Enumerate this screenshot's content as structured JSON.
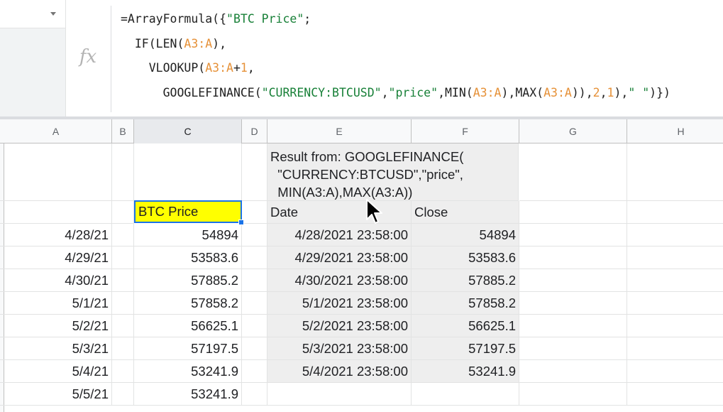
{
  "formula_bar": {
    "fx_label": "fx",
    "lines": [
      [
        {
          "t": "=ArrayFormula({",
          "c": "n"
        },
        {
          "t": "\"BTC Price\"",
          "c": "g"
        },
        {
          "t": ";",
          "c": "n"
        }
      ],
      [
        {
          "t": "  IF(LEN(",
          "c": "n"
        },
        {
          "t": "A3:A",
          "c": "o"
        },
        {
          "t": "),",
          "c": "n"
        }
      ],
      [
        {
          "t": "    VLOOKUP(",
          "c": "n"
        },
        {
          "t": "A3:A",
          "c": "o"
        },
        {
          "t": "+",
          "c": "n"
        },
        {
          "t": "1",
          "c": "o"
        },
        {
          "t": ",",
          "c": "n"
        }
      ],
      [
        {
          "t": "      GOOGLEFINANCE(",
          "c": "n"
        },
        {
          "t": "\"CURRENCY:BTCUSD\"",
          "c": "g"
        },
        {
          "t": ",",
          "c": "n"
        },
        {
          "t": "\"price\"",
          "c": "g"
        },
        {
          "t": ",MIN(",
          "c": "n"
        },
        {
          "t": "A3:A",
          "c": "o"
        },
        {
          "t": "),MAX(",
          "c": "n"
        },
        {
          "t": "A3:A",
          "c": "o"
        },
        {
          "t": ")),",
          "c": "n"
        },
        {
          "t": "2",
          "c": "o"
        },
        {
          "t": ",",
          "c": "n"
        },
        {
          "t": "1",
          "c": "o"
        },
        {
          "t": "),",
          "c": "n"
        },
        {
          "t": "\" \"",
          "c": "g"
        },
        {
          "t": ")})",
          "c": "n"
        }
      ]
    ]
  },
  "columns": [
    "A",
    "B",
    "C",
    "D",
    "E",
    "F",
    "G",
    "H"
  ],
  "note_text": "Result from: GOOGLEFINANCE(\n  \"CURRENCY:BTCUSD\",\"price\",\n  MIN(A3:A),MAX(A3:A))",
  "header_row": {
    "c": "BTC Price",
    "e": "Date",
    "f": "Close"
  },
  "rows": [
    {
      "a": "4/28/21",
      "c": "54894",
      "e": "4/28/2021 23:58:00",
      "f": "54894"
    },
    {
      "a": "4/29/21",
      "c": "53583.6",
      "e": "4/29/2021 23:58:00",
      "f": "53583.6"
    },
    {
      "a": "4/30/21",
      "c": "57885.2",
      "e": "4/30/2021 23:58:00",
      "f": "57885.2"
    },
    {
      "a": "5/1/21",
      "c": "57858.2",
      "e": "5/1/2021 23:58:00",
      "f": "57858.2"
    },
    {
      "a": "5/2/21",
      "c": "56625.1",
      "e": "5/2/2021 23:58:00",
      "f": "56625.1"
    },
    {
      "a": "5/3/21",
      "c": "57197.5",
      "e": "5/3/2021 23:58:00",
      "f": "57197.5"
    },
    {
      "a": "5/4/21",
      "c": "53241.9",
      "e": "5/4/2021 23:58:00",
      "f": "53241.9"
    },
    {
      "a": "5/5/21",
      "c": "53241.9",
      "e": "",
      "f": ""
    }
  ],
  "colors": {
    "selection": "#1a73e8",
    "highlight": "#ffff00",
    "result_bg": "#eeeeee",
    "formula_green": "#188038",
    "formula_orange": "#e69138"
  }
}
